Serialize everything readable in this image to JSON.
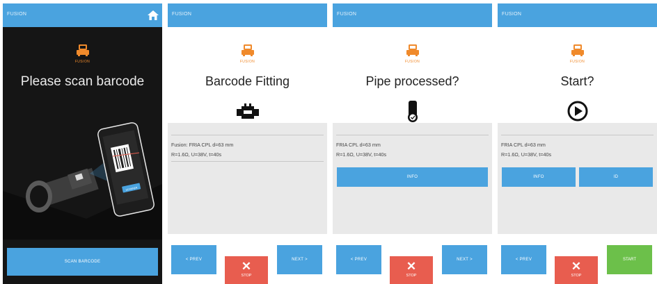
{
  "colors": {
    "topbar": "#4aa3df",
    "accent": "#f08a2b",
    "stop": "#e85d4f",
    "start": "#6cc04a",
    "dark_bg": "#151515"
  },
  "panel1": {
    "app_title": "FUSION",
    "logo_label": "FUSION",
    "heading": "Please scan barcode",
    "scan_button": "SCAN BARCODE",
    "phone_button": "SCANNER",
    "home_icon": "home-icon"
  },
  "panel2": {
    "app_title": "FUSION",
    "logo_label": "FUSION",
    "heading": "Barcode Fitting",
    "line1": "Fusion: FRIA CPL d=63 mm",
    "line2": "R=1.6Ω, U=38V, t=40s",
    "prev": "< PREV",
    "stop": "STOP",
    "next": "NEXT >"
  },
  "panel3": {
    "app_title": "FUSION",
    "logo_label": "FUSION",
    "heading": "Pipe processed?",
    "line1": "FRIA CPL d=63 mm",
    "line2": "R=1.6Ω, U=38V, t=40s",
    "info": "INFO",
    "prev": "< PREV",
    "stop": "STOP",
    "next": "NEXT >"
  },
  "panel4": {
    "app_title": "FUSION",
    "logo_label": "FUSION",
    "heading": "Start?",
    "line1": "FRIA CPL d=63 mm",
    "line2": "R=1.6Ω, U=38V, t=40s",
    "info": "INFO",
    "id": "ID",
    "prev": "< PREV",
    "stop": "STOP",
    "start": "START"
  }
}
